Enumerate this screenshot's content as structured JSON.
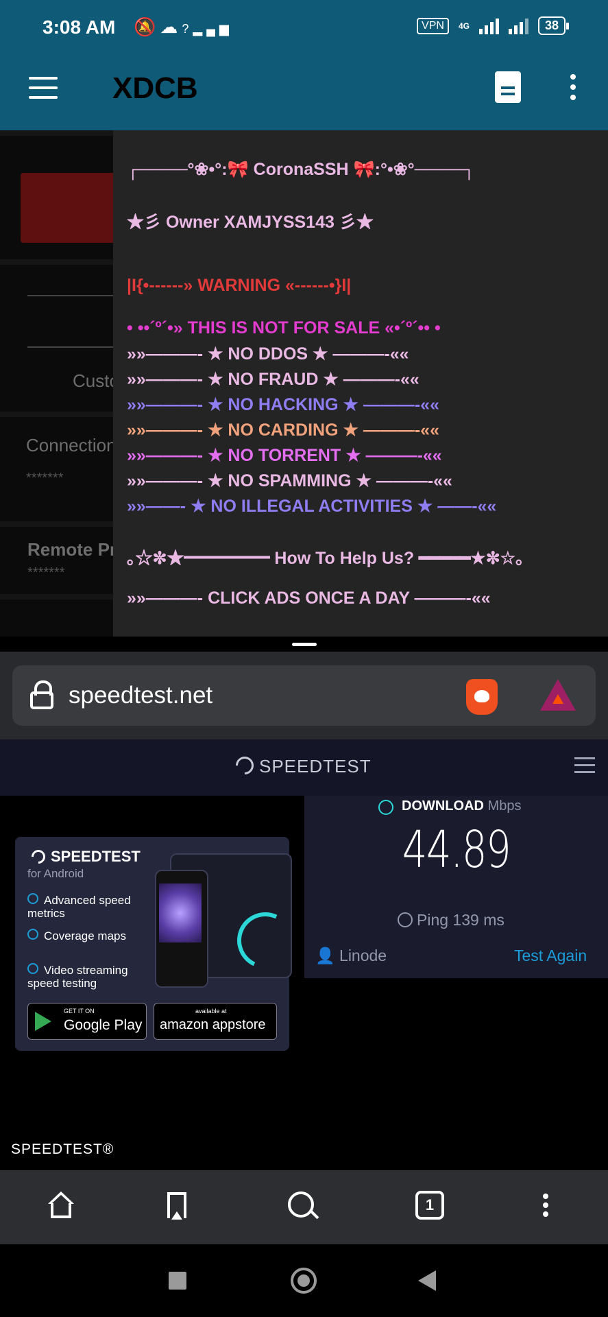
{
  "status_bar": {
    "time": "3:08 AM",
    "vpn": "VPN",
    "network": "4G",
    "battery": "38"
  },
  "app": {
    "title": "XDCB"
  },
  "background_app": {
    "custom_label": "Custo",
    "connection_label": "Connection",
    "connection_value": "*******",
    "remote_label": "Remote Pr",
    "remote_value": "*******"
  },
  "dialog": {
    "lines": [
      {
        "text": "┌────°❀•°:🎀 CoronaSSH 🎀:°•❀°────┐",
        "color": "#e9b9e4"
      },
      {
        "text": "★彡 Owner XAMJYSS143 彡★",
        "color": "#e9b9e4"
      },
      {
        "text": "|I{•------» WARNING «------•}I|",
        "color": "#e23a3a"
      },
      {
        "text": "• ••´º´•» THIS IS NOT FOR SALE «•´º´•• •",
        "color": "#e43ccf"
      },
      {
        "text": "»»———- ★ NO DDOS ★ ———-««",
        "color": "#e9b9e4"
      },
      {
        "text": "»»———- ★ NO FRAUD ★ ———-««",
        "color": "#e9b9e4"
      },
      {
        "text": "»»———- ★ NO HACKING ★ ———-««",
        "color": "#8f7df2"
      },
      {
        "text": "»»———- ★ NO CARDING ★ ———-««",
        "color": "#f0a27c"
      },
      {
        "text": "»»———- ★ NO TORRENT ★ ———-««",
        "color": "#e46ef0"
      },
      {
        "text": "»»———- ★ NO SPAMMING ★ ———-««",
        "color": "#e9b9e4"
      },
      {
        "text": "»»——- ★ NO ILLEGAL ACTIVITIES ★ ——-««",
        "color": "#8f7df2"
      },
      {
        "text": "｡☆✼★━━━━━ How To Help Us? ━━━━━★✼☆｡",
        "color": "#e9b9e4"
      },
      {
        "text": "»»———- CLICK ADS ONCE A DAY ———-««",
        "color": "#e9b9e4"
      }
    ]
  },
  "browser": {
    "url": "speedtest.net",
    "tab_count": "1"
  },
  "speedtest": {
    "logo": "SPEEDTEST",
    "download_label": "DOWNLOAD",
    "download_unit": "Mbps",
    "download_value": "44.89",
    "ping_label": "Ping 139 ms",
    "server": "Linode",
    "test_again": "Test Again",
    "footer": "SPEEDTEST®"
  },
  "promo": {
    "title": "SPEEDTEST",
    "subtitle": "for Android",
    "features": [
      "Advanced speed metrics",
      "Coverage maps",
      "Video streaming speed testing"
    ],
    "google_small": "GET IT ON",
    "google_big": "Google Play",
    "amazon_small": "available at",
    "amazon_big": "amazon appstore"
  }
}
